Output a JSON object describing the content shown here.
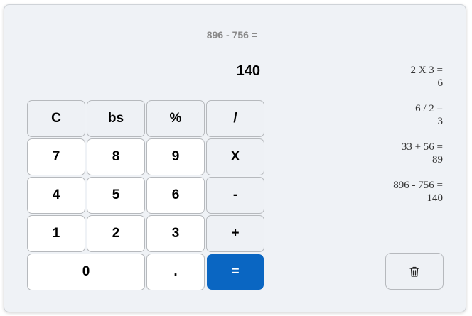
{
  "display": {
    "expression": "896 - 756 =",
    "result": "140"
  },
  "keys": {
    "clear": "C",
    "backspace": "bs",
    "percent": "%",
    "divide": "/",
    "seven": "7",
    "eight": "8",
    "nine": "9",
    "multiply": "X",
    "four": "4",
    "five": "5",
    "six": "6",
    "minus": "-",
    "one": "1",
    "two": "2",
    "three": "3",
    "plus": "+",
    "zero": "0",
    "decimal": ".",
    "equals": "="
  },
  "history": [
    {
      "expression": "2 X 3 =",
      "result": "6"
    },
    {
      "expression": "6 / 2 =",
      "result": "3"
    },
    {
      "expression": "33 + 56 =",
      "result": "89"
    },
    {
      "expression": "896 - 756 =",
      "result": "140"
    }
  ],
  "colors": {
    "accent": "#0a66c2",
    "panel": "#eff2f6",
    "key": "#eef1f5",
    "number_key": "#ffffff"
  },
  "icons": {
    "clear_history": "trash-icon"
  }
}
